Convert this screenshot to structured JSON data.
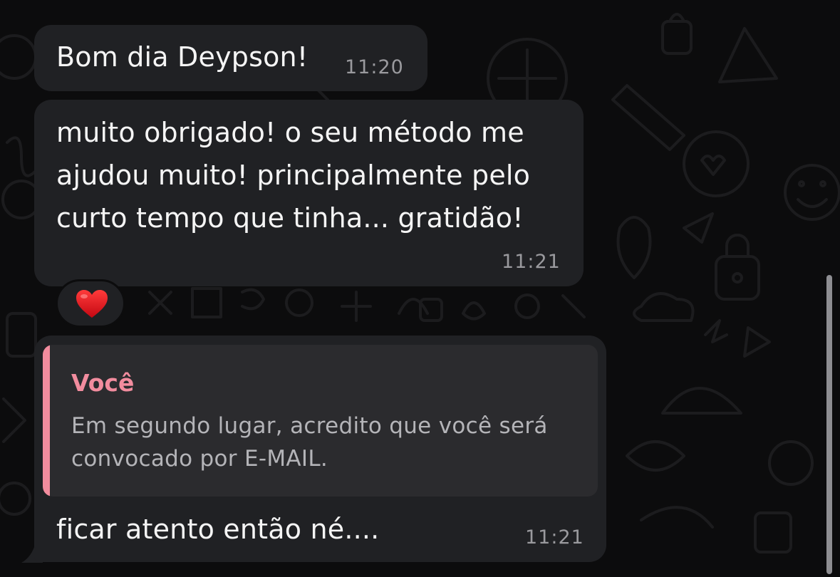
{
  "messages": [
    {
      "text": "Bom dia Deypson!",
      "time": "11:20"
    },
    {
      "text": "muito obrigado! o seu método me ajudou muito! principalmente pelo curto tempo que tinha... gratidão!",
      "time": "11:21",
      "reaction": "red-heart"
    },
    {
      "quote": {
        "author": "Você",
        "text": "Em segundo lugar, acredito que você será convocado por E-MAIL."
      },
      "text": "ficar atento então né....",
      "time": "11:21"
    }
  ],
  "colors": {
    "bubble": "#202124",
    "quote_background": "#2b2b2e",
    "quote_accent": "#f28c9e",
    "timestamp": "#9a9a9e",
    "background": "#0c0c0d"
  }
}
